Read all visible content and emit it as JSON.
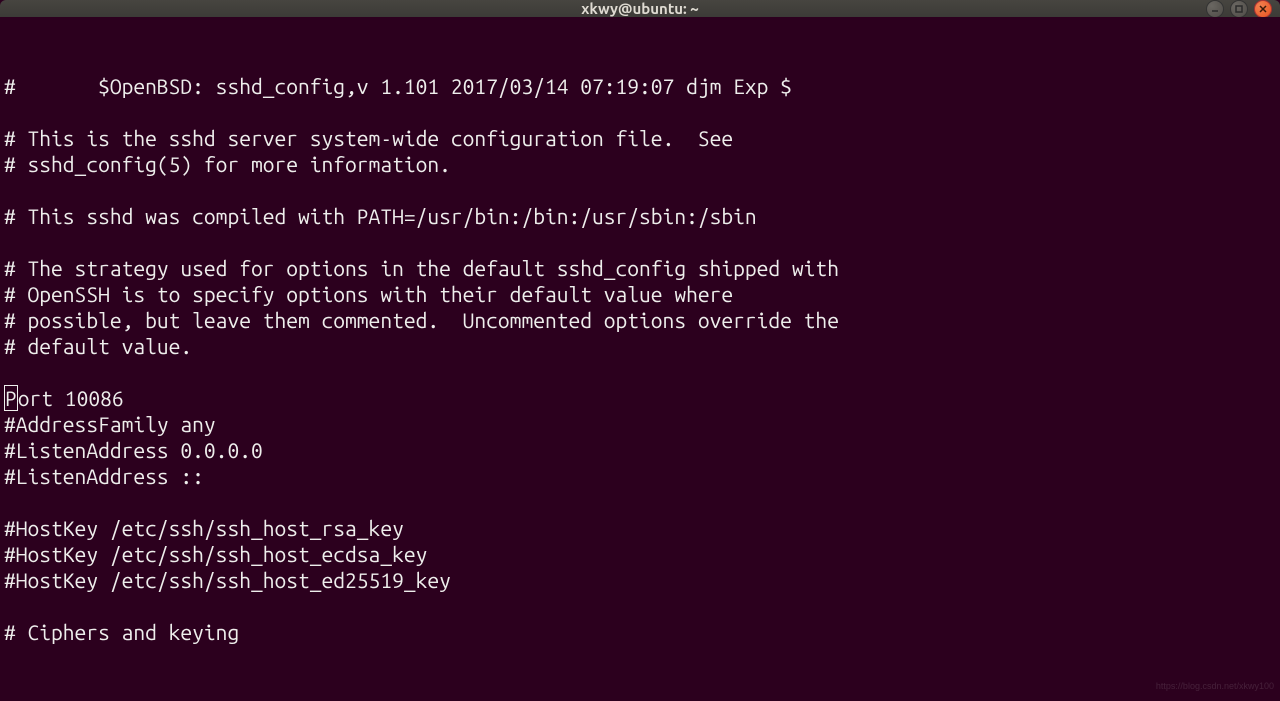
{
  "titlebar": {
    "text": "xkwy@ubuntu: ~"
  },
  "terminal": {
    "lines": [
      "#       $OpenBSD: sshd_config,v 1.101 2017/03/14 07:19:07 djm Exp $",
      "",
      "# This is the sshd server system-wide configuration file.  See",
      "# sshd_config(5) for more information.",
      "",
      "# This sshd was compiled with PATH=/usr/bin:/bin:/usr/sbin:/sbin",
      "",
      "# The strategy used for options in the default sshd_config shipped with",
      "# OpenSSH is to specify options with their default value where",
      "# possible, but leave them commented.  Uncommented options override the",
      "# default value.",
      "",
      "[[CURSOR:P]]ort 10086",
      "#AddressFamily any",
      "#ListenAddress 0.0.0.0",
      "#ListenAddress ::",
      "",
      "#HostKey /etc/ssh/ssh_host_rsa_key",
      "#HostKey /etc/ssh/ssh_host_ecdsa_key",
      "#HostKey /etc/ssh/ssh_host_ed25519_key",
      "",
      "# Ciphers and keying"
    ]
  },
  "watermark": "https://blog.csdn.net/xkwy100"
}
